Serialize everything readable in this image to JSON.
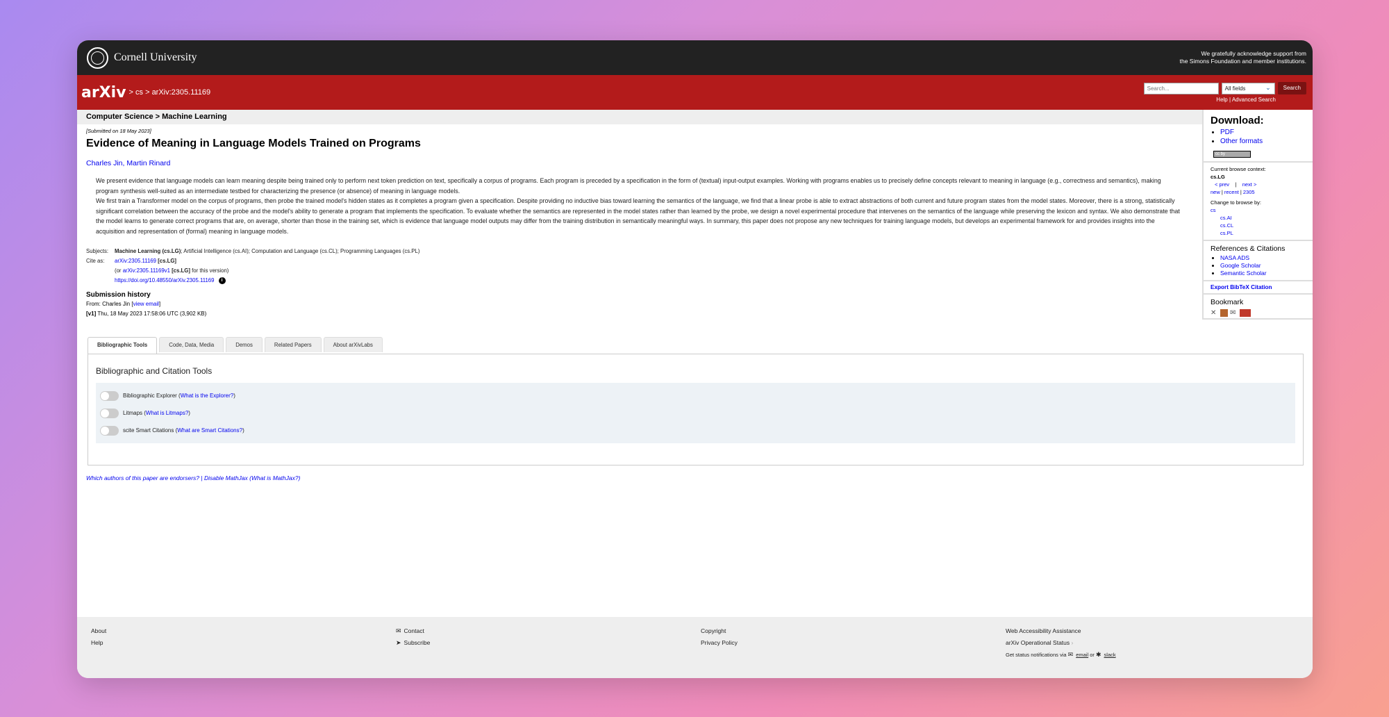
{
  "cornell": {
    "name": "Cornell University",
    "support_line1": "We gratefully acknowledge support from",
    "support_line2": "the Simons Foundation and member institutions."
  },
  "header": {
    "logo": "arXiv",
    "breadcrumb": "> cs > arXiv:2305.11169",
    "search_placeholder": "Search...",
    "search_field": "All fields",
    "search_button": "Search",
    "help": "Help",
    "advanced": "Advanced Search"
  },
  "paper": {
    "subject_header": "Computer Science > Machine Learning",
    "submitted": "[Submitted on 18 May 2023]",
    "title": "Evidence of Meaning in Language Models Trained on Programs",
    "authors": "Charles Jin, Martin Rinard",
    "abstract_p1": "We present evidence that language models can learn meaning despite being trained only to perform next token prediction on text, specifically a corpus of programs. Each program is preceded by a specification in the form of (textual) input-output examples. Working with programs enables us to precisely define concepts relevant to meaning in language (e.g., correctness and semantics), making program synthesis well-suited as an intermediate testbed for characterizing the presence (or absence) of meaning in language models.",
    "abstract_p2": "We first train a Transformer model on the corpus of programs, then probe the trained model's hidden states as it completes a program given a specification. Despite providing no inductive bias toward learning the semantics of the language, we find that a linear probe is able to extract abstractions of both current and future program states from the model states. Moreover, there is a strong, statistically significant correlation between the accuracy of the probe and the model's ability to generate a program that implements the specification. To evaluate whether the semantics are represented in the model states rather than learned by the probe, we design a novel experimental procedure that intervenes on the semantics of the language while preserving the lexicon and syntax. We also demonstrate that the model learns to generate correct programs that are, on average, shorter than those in the training set, which is evidence that language model outputs may differ from the training distribution in semantically meaningful ways. In summary, this paper does not propose any new techniques for training language models, but develops an experimental framework for and provides insights into the acquisition and representation of (formal) meaning in language models.",
    "subjects_label": "Subjects:",
    "subjects_main": "Machine Learning (cs.LG)",
    "subjects_rest": "; Artificial Intelligence (cs.AI); Computation and Language (cs.CL); Programming Languages (cs.PL)",
    "cite_label": "Cite as:",
    "cite_id": "arXiv:2305.11169",
    "cite_tag": "[cs.LG]",
    "cite_or_open": "(or ",
    "cite_version": "arXiv:2305.11169v1",
    "cite_version_tag": "[cs.LG]",
    "cite_version_rest": " for this version)",
    "doi": "https://doi.org/10.48550/arXiv.2305.11169",
    "history_title": "Submission history",
    "history_from": "From: Charles Jin [",
    "view_email": "view email",
    "history_from_close": "]",
    "history_v1": "[v1]",
    "history_v1_rest": " Thu, 18 May 2023 17:58:06 UTC (3,902 KB)"
  },
  "tabs": [
    {
      "label": "Bibliographic Tools"
    },
    {
      "label": "Code, Data, Media"
    },
    {
      "label": "Demos"
    },
    {
      "label": "Related Papers"
    },
    {
      "label": "About arXivLabs"
    }
  ],
  "tools": {
    "title": "Bibliographic and Citation Tools",
    "items": [
      {
        "label": "Bibliographic Explorer (",
        "link": "What is the Explorer?",
        "close": ")"
      },
      {
        "label": "Litmaps (",
        "link": "What is Litmaps?",
        "close": ")"
      },
      {
        "label": "scite Smart Citations (",
        "link": "What are Smart Citations?",
        "close": ")"
      }
    ]
  },
  "endorsers": {
    "q": "Which authors of this paper are endorsers?",
    "sep": " | ",
    "disable": "Disable MathJax",
    "open": " (",
    "what": "What is MathJax?",
    "close": ")"
  },
  "sidebar": {
    "download": "Download:",
    "pdf": "PDF",
    "other": "Other formats",
    "license": "cc by",
    "context_label": "Current browse context:",
    "context": "cs.LG",
    "prev": "< prev",
    "bar": "|",
    "next": "next >",
    "new": "new",
    "recent": "recent",
    "month": "2305",
    "change_label": "Change to browse by:",
    "browse": [
      "cs",
      "cs.AI",
      "cs.CL",
      "cs.PL"
    ],
    "refs_title": "References & Citations",
    "refs": [
      "NASA ADS",
      "Google Scholar",
      "Semantic Scholar"
    ],
    "export": "Export BibTeX Citation",
    "bookmark": "Bookmark"
  },
  "footer": {
    "about": "About",
    "help": "Help",
    "contact": "Contact",
    "subscribe": "Subscribe",
    "copyright": "Copyright",
    "privacy": "Privacy Policy",
    "accessibility": "Web Accessibility Assistance",
    "status": "arXiv Operational Status",
    "notify": "Get status notifications via",
    "email": "email",
    "or": "or",
    "slack": "slack"
  },
  "colors": {
    "arxiv_red": "#b31b1b",
    "cornell_bar": "#222222",
    "link": "#0000ee"
  }
}
